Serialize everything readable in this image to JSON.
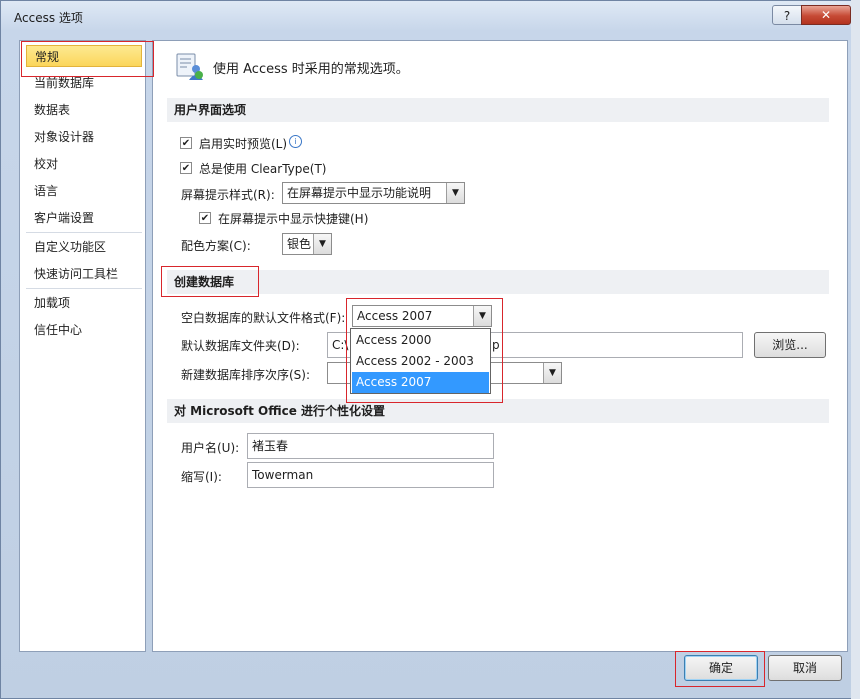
{
  "window": {
    "title": "Access 选项",
    "help_label": "?",
    "close_label": "✕"
  },
  "sidebar": {
    "items": [
      {
        "label": "常规",
        "selected": true
      },
      {
        "label": "当前数据库"
      },
      {
        "label": "数据表"
      },
      {
        "label": "对象设计器"
      },
      {
        "label": "校对"
      },
      {
        "label": "语言"
      },
      {
        "label": "客户端设置"
      },
      {
        "label": "自定义功能区"
      },
      {
        "label": "快速访问工具栏"
      },
      {
        "label": "加载项"
      },
      {
        "label": "信任中心"
      }
    ]
  },
  "main": {
    "header_text": "使用 Access 时采用的常规选项。",
    "header_icon": "options-icon",
    "ui_section": {
      "title": "用户界面选项",
      "live_preview": {
        "label": "启用实时预览(L)",
        "checked": true
      },
      "cleartype": {
        "label": "总是使用 ClearType(T)",
        "checked": true
      },
      "screentip_style": {
        "label": "屏幕提示样式(R):",
        "value": "在屏幕提示中显示功能说明"
      },
      "show_shortcut": {
        "label": "在屏幕提示中显示快捷键(H)",
        "checked": true
      },
      "color_scheme": {
        "label": "配色方案(C):",
        "value": "银色"
      }
    },
    "db_section": {
      "title": "创建数据库",
      "default_format": {
        "label": "空白数据库的默认文件格式(F):",
        "value": "Access 2007"
      },
      "default_folder": {
        "label": "默认数据库文件夹(D):",
        "value_start": "C:\\",
        "value_end": "p"
      },
      "sort_order": {
        "label": "新建数据库排序次序(S):"
      },
      "browse_label": "浏览...",
      "dropdown_options": [
        "Access 2000",
        "Access 2002 - 2003",
        "Access 2007"
      ],
      "dropdown_selected": "Access 2007"
    },
    "office_section": {
      "title": "对 Microsoft Office 进行个性化设置",
      "username": {
        "label": "用户名(U):",
        "value": "褚玉春"
      },
      "initials": {
        "label": "缩写(I):",
        "value": "Towerman"
      }
    }
  },
  "footer": {
    "ok_label": "确定",
    "cancel_label": "取消"
  },
  "colors": {
    "highlight_red": "#d8262c",
    "selection_blue": "#3399ff",
    "sidebar_selected": "#fbd65b"
  }
}
